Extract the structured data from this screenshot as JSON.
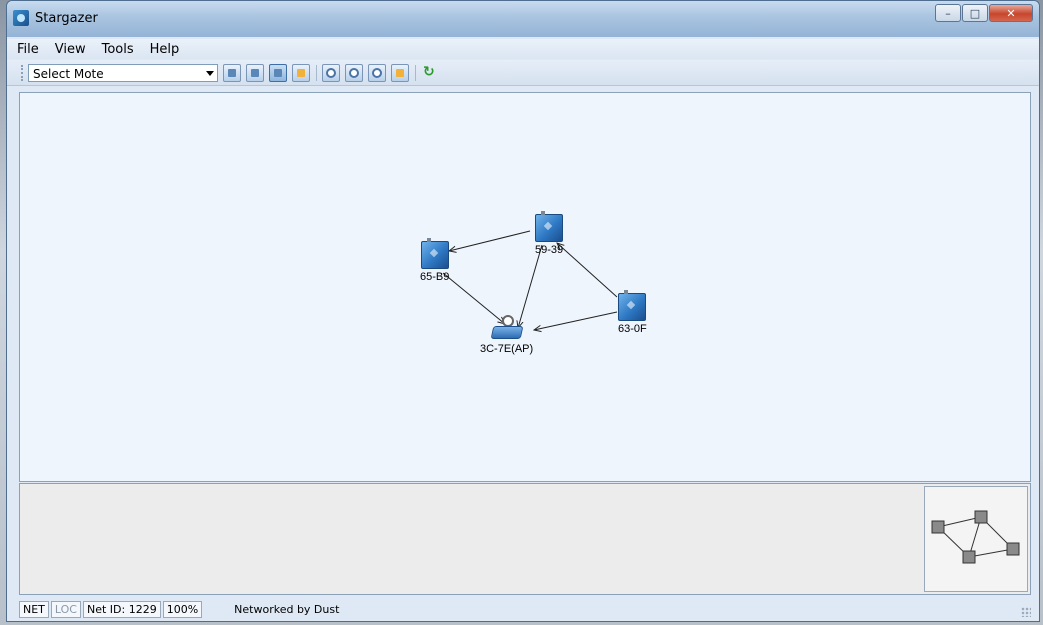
{
  "window": {
    "title": "Stargazer",
    "controls": {
      "minimize": "–",
      "maximize": "□",
      "close": "✕"
    }
  },
  "menu": [
    "File",
    "View",
    "Tools",
    "Help"
  ],
  "toolbar": {
    "select_value": "Select Mote",
    "buttons": [
      "view-icon",
      "mote-icon",
      "fit-icon",
      "layout-icon",
      "zoom-icon",
      "zoom-in-icon",
      "zoom-out-icon",
      "actual-size-icon",
      "refresh-icon"
    ]
  },
  "network": {
    "nodes": [
      {
        "id": "n1",
        "label": "59-39",
        "kind": "mote"
      },
      {
        "id": "n2",
        "label": "65-B9",
        "kind": "mote"
      },
      {
        "id": "n3",
        "label": "63-0F",
        "kind": "mote"
      },
      {
        "id": "n4",
        "label": "3C-7E(AP)",
        "kind": "ap"
      }
    ],
    "links": [
      {
        "from": "59-39",
        "to": "65-B9"
      },
      {
        "from": "59-39",
        "to": "3C-7E(AP)"
      },
      {
        "from": "65-B9",
        "to": "3C-7E(AP)"
      },
      {
        "from": "63-0F",
        "to": "59-39"
      },
      {
        "from": "63-0F",
        "to": "3C-7E(AP)"
      }
    ]
  },
  "status": {
    "net": "NET",
    "loc": "LOC",
    "net_id": "Net ID: 1229",
    "zoom": "100%",
    "text": "Networked by Dust"
  },
  "colors": {
    "canvas": "#eef5fd",
    "link": "#222222",
    "mote": "#2e78c4"
  }
}
